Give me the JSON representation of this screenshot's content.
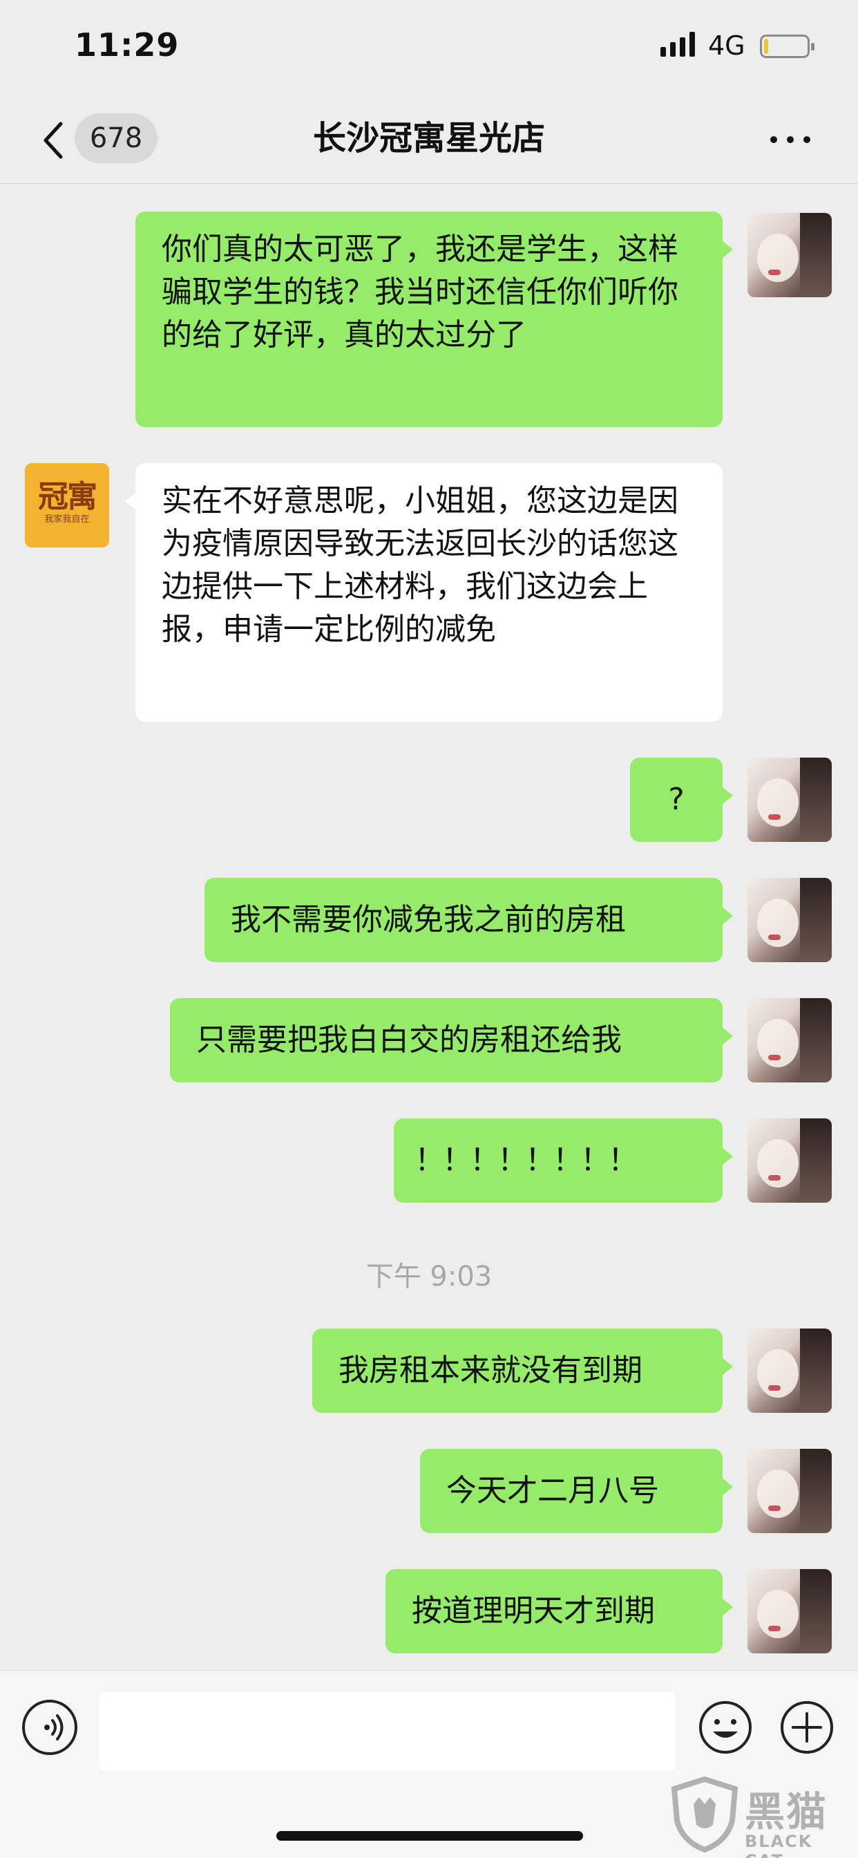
{
  "status_bar": {
    "time": "11:29",
    "network": "4G"
  },
  "nav": {
    "unread_count": "678",
    "title": "长沙冠寓星光店"
  },
  "contact_avatar": {
    "logo_text": "冠寓",
    "logo_subtext": "我家我自在"
  },
  "messages": [
    {
      "from": "me",
      "text": "你们真的太可恶了，我还是学生，这样骗取学生的钱？我当时还信任你们听你的给了好评，真的太过分了"
    },
    {
      "from": "other",
      "text": "实在不好意思呢，小姐姐，您这边是因为疫情原因导致无法返回长沙的话您这边提供一下上述材料，我们这边会上报，申请一定比例的减免"
    },
    {
      "from": "me",
      "text": "?"
    },
    {
      "from": "me",
      "text": "我不需要你减免我之前的房租"
    },
    {
      "from": "me",
      "text": "只需要把我白白交的房租还给我"
    },
    {
      "from": "me",
      "text": "！！！！！！！！"
    },
    {
      "from": "me",
      "text": "我房租本来就没有到期"
    },
    {
      "from": "me",
      "text": "今天才二月八号"
    },
    {
      "from": "me",
      "text": "按道理明天才到期"
    }
  ],
  "timestamp": "下午 9:03",
  "watermark": {
    "cn": "黑猫",
    "en": "BLACK CAT"
  },
  "colors": {
    "my_bubble": "#95ec69",
    "other_bubble": "#ffffff",
    "background": "#ededed"
  }
}
